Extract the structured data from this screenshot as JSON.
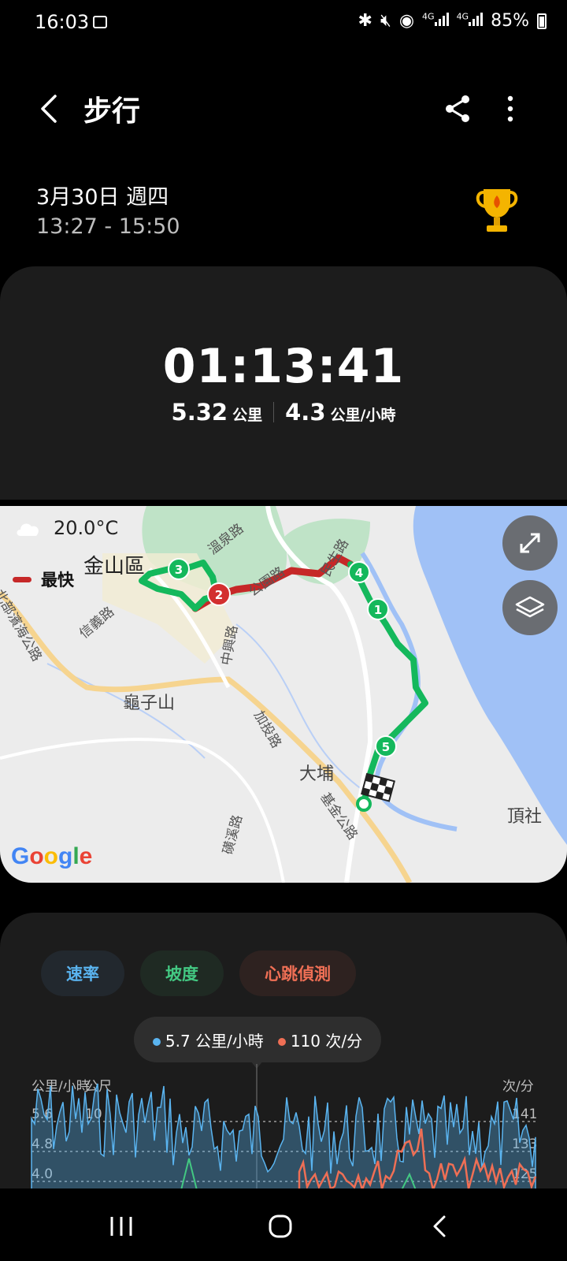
{
  "status_bar": {
    "time": "16:03",
    "network_1": "4G",
    "network_2": "4G",
    "battery": "85%",
    "icons": [
      "image-icon",
      "bluetooth-icon",
      "mute-icon",
      "hotspot-icon",
      "signal-icon",
      "battery-icon"
    ]
  },
  "header": {
    "title": "步行"
  },
  "session": {
    "date": "3月30日 週四",
    "time_range": "13:27 - 15:50"
  },
  "summary": {
    "duration": "01:13:41",
    "distance_value": "5.32",
    "distance_unit": "公里",
    "speed_value": "4.3",
    "speed_unit": "公里/小時"
  },
  "map": {
    "weather": "20.0°C",
    "legend_fastest": "最快",
    "place_labels": [
      "金山區",
      "龜子山",
      "大埔",
      "頂社"
    ],
    "road_labels": [
      "溫泉路",
      "公園路",
      "民生路",
      "信義路",
      "中興路",
      "北部濱海公路",
      "加投路",
      "基金公路",
      "磺溪路"
    ],
    "markers": [
      "1",
      "2",
      "3",
      "4",
      "5"
    ],
    "attribution": "Google",
    "colors": {
      "fast": "#c62828",
      "normal": "#14b85c",
      "water": "#a0c1f6",
      "park": "#bfe3c7"
    }
  },
  "chart": {
    "tabs": [
      "速率",
      "坡度",
      "心跳偵測"
    ],
    "tooltip_speed": "5.7 公里/小時",
    "tooltip_heart": "110 次/分",
    "left_unit": "公里/小時",
    "left_unit_2": "公尺",
    "right_unit": "次/分",
    "left_ticks": [
      "5.6",
      "4.8",
      "4.0"
    ],
    "slope_tick": "10",
    "right_ticks": [
      "141",
      "133",
      "125"
    ],
    "colors": {
      "speed": "#5ab4f0",
      "slope": "#43c882",
      "heart": "#ef6f55"
    }
  }
}
